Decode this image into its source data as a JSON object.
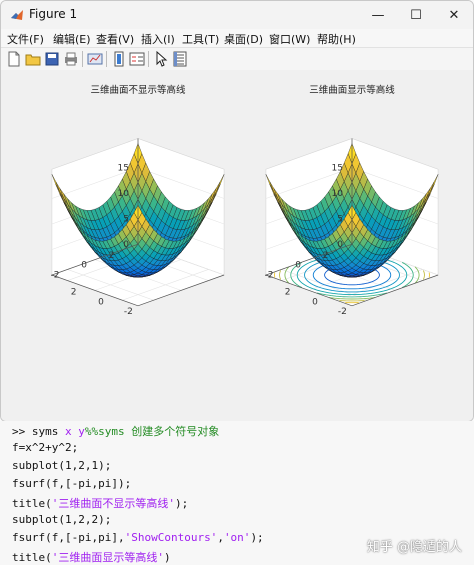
{
  "window": {
    "title": "Figure 1",
    "minimize_glyph": "—",
    "maximize_glyph": "☐",
    "close_glyph": "✕"
  },
  "menu": [
    "文件(F)",
    "编辑(E)",
    "查看(V)",
    "插入(I)",
    "工具(T)",
    "桌面(D)",
    "窗口(W)",
    "帮助(H)"
  ],
  "toolbar": [
    "new-figure-icon",
    "open-file-icon",
    "save-icon",
    "print-icon",
    "link-plot-icon",
    "insert-colorbar-icon",
    "insert-legend-icon",
    "pointer-icon",
    "property-editor-icon"
  ],
  "plots": {
    "left": {
      "title": "三维曲面不显示等高线",
      "z_ticks": [
        "15",
        "10",
        "5",
        "0"
      ],
      "y_ticks": [
        "2",
        "0",
        "-2"
      ],
      "x_ticks": [
        "-2",
        "0",
        "2"
      ]
    },
    "right": {
      "title": "三维曲面显示等高线",
      "z_ticks": [
        "15",
        "10",
        "5",
        "0"
      ],
      "y_ticks": [
        "2",
        "0",
        "-2"
      ],
      "x_ticks": [
        "-2",
        "0",
        "2"
      ]
    }
  },
  "code": {
    "line1_prompt": ">> ",
    "line1_cmd": "syms ",
    "line1_var": "x y",
    "line1_comment": "%%syms 创建多个符号对象",
    "line2": "f=x^2+y^2;",
    "line3": "subplot(1,2,1);",
    "line4": "fsurf(f,[-pi,pi]);",
    "line5_pre": "title(",
    "line5_str": "'三维曲面不显示等高线'",
    "line5_post": ");",
    "line6": "subplot(1,2,2);",
    "line7_pre": "fsurf(f,[-pi,pi],",
    "line7_str1": "'ShowContours'",
    "line7_mid": ",",
    "line7_str2": "'on'",
    "line7_post": ");",
    "line8_pre": "title(",
    "line8_str": "'三维曲面显示等高线'",
    "line8_post": ")"
  },
  "watermark": "知乎 @隐遁的人"
}
